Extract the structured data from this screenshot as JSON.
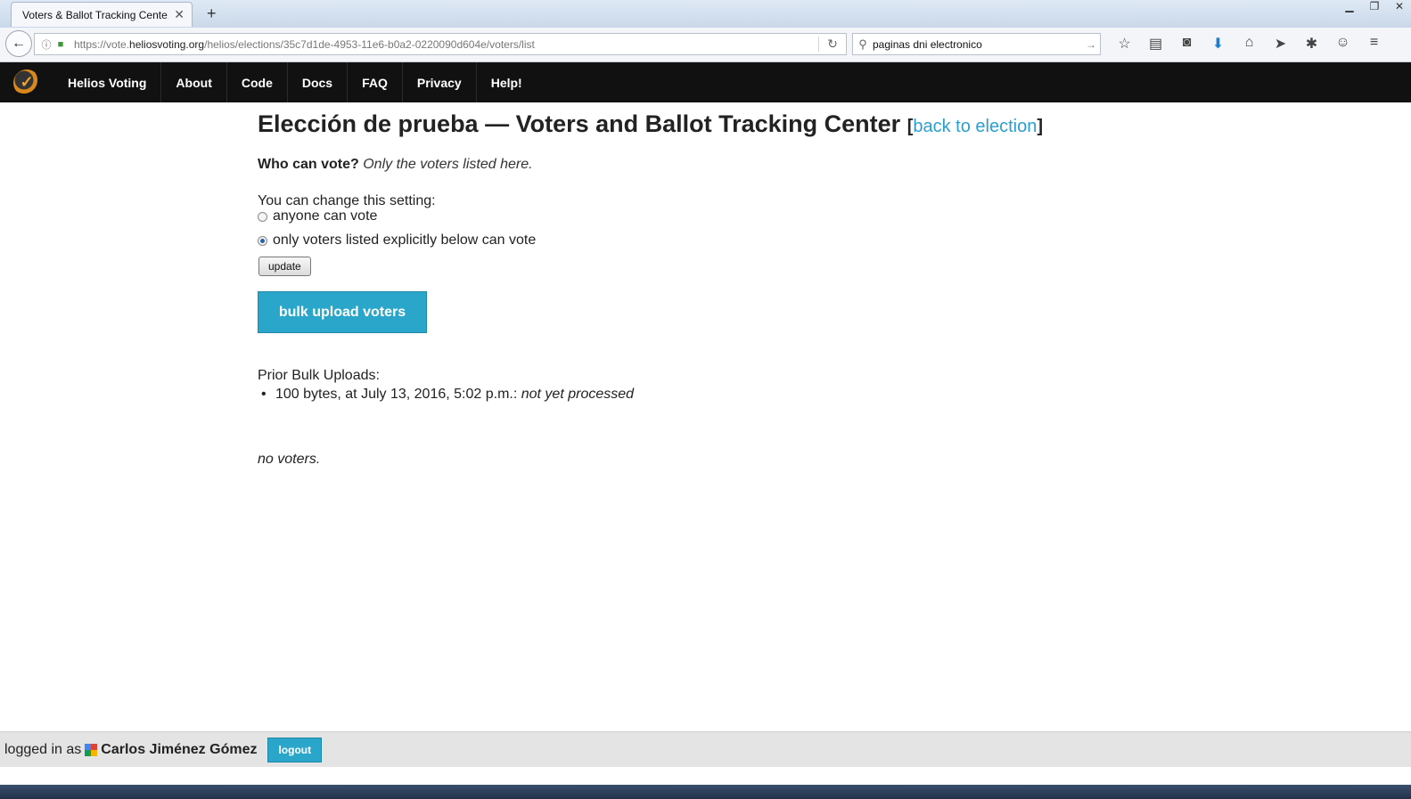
{
  "browser": {
    "tab_title": "Voters & Ballot Tracking Cente...",
    "url_prefix": "https://vote.",
    "url_domain": "heliosvoting.org",
    "url_path": "/helios/elections/35c7d1de-4953-11e6-b0a2-0220090d604e/voters/list",
    "search_value": "paginas dni electronico"
  },
  "nav": {
    "brand": "Helios Voting",
    "items": [
      "About",
      "Code",
      "Docs",
      "FAQ",
      "Privacy",
      "Help!"
    ]
  },
  "page": {
    "title": "Elección de prueba — Voters and Ballot Tracking Center",
    "back_link": "back to election",
    "who_label": "Who can vote?",
    "who_value": "Only the voters listed here.",
    "change_setting": "You can change this setting:",
    "option_anyone": "anyone can vote",
    "option_listed": "only voters listed explicitly below can vote",
    "selected_option": "only voters listed explicitly below can vote",
    "update_button": "update",
    "bulk_button": "bulk upload voters",
    "prior_label": "Prior Bulk Uploads:",
    "prior_upload_text": "100 bytes, at July 13, 2016, 5:02 p.m.:",
    "prior_upload_status": "not yet processed",
    "no_voters": "no voters."
  },
  "footer": {
    "logged_in_prefix": "logged in as",
    "username": "Carlos Jiménez Gómez",
    "logout": "logout"
  },
  "colors": {
    "header_bg": "#111111",
    "accent": "#2ba6cb",
    "link": "#2a9fd0",
    "footer_bg": "#e4e4e4"
  }
}
